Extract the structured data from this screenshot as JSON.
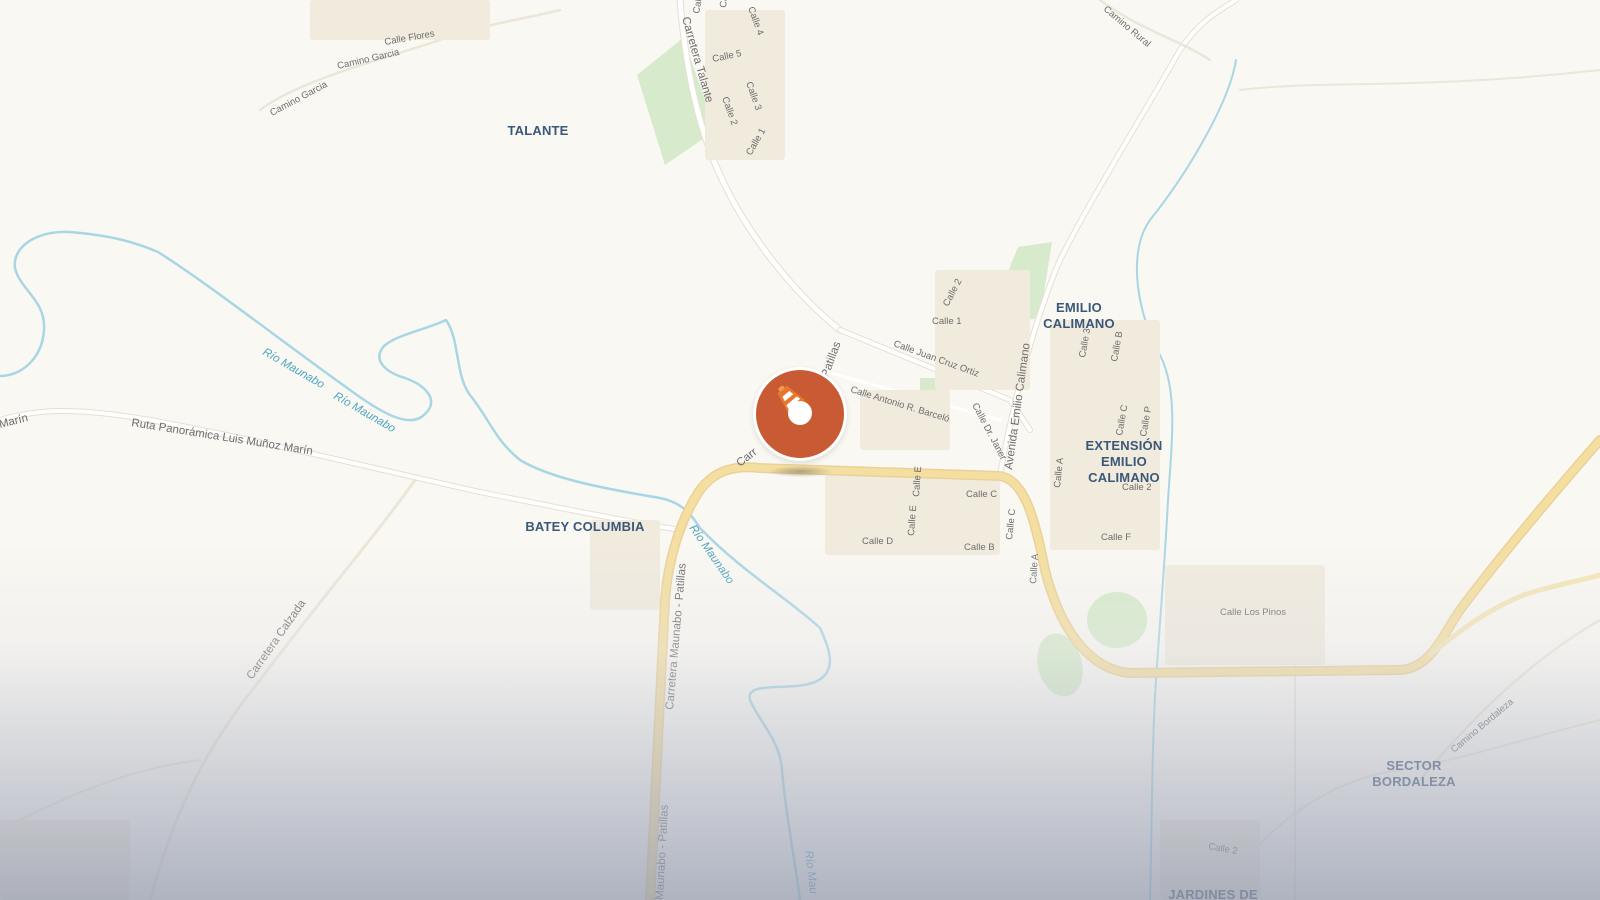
{
  "places": {
    "talante": "TALANTE",
    "batey_columbia": "BATEY COLUMBIA",
    "emilio_1": "EMILIO",
    "emilio_2": "CALIMANO",
    "extension_1": "EXTENSIÓN",
    "extension_2": "EMILIO",
    "extension_3": "CALIMANO",
    "sector_1": "SECTOR",
    "sector_2": "BORDALEZA",
    "jardines": "JARDINES DE"
  },
  "roads": {
    "carretera_talante": "Carretera Talante",
    "ruta_panoramica": "Ruta Panorámica Luis Muñoz Marín",
    "marin": "Marín",
    "carretera_maunabo_patillas": "Carretera Maunabo - Patillas",
    "maunabo_patillas_bottom": "Maunabo - Patillas",
    "carretera_calzada": "Carretera Calzada",
    "avenida_emilio": "Avenida Emilio Calimano",
    "calle_juan_cruz": "Calle Juan Cruz Ortiz",
    "calle_antonio": "Calle Antonio R. Barceló",
    "calle_dr_janer": "Calle Dr. Janer",
    "calle_flores": "Calle Flores",
    "camino_garcia_1": "Camino Garcia",
    "camino_garcia_2": "Camino Garcia",
    "camino_rural": "Camino Rural",
    "camino_bordaleza": "Camino Bordaleza",
    "calle_los_pinos": "Calle Los Pinos",
    "calle_1": "Calle 1",
    "calle_1b": "Calle 1",
    "calle_2": "Calle 2",
    "calle_2b": "Calle 2",
    "calle_2c": "Calle 2",
    "calle_2d": "Calle 2",
    "calle_3": "Calle 3",
    "calle_3b": "Calle 3",
    "calle_4": "Calle 4",
    "calle_5": "Calle 5",
    "calle_a": "Calle A",
    "calle_a2": "Calle A",
    "calle_a3": "Calle A",
    "calle_b": "Calle B",
    "calle_b2": "Calle B",
    "calle_b3": "Calle B",
    "calle_c": "Calle C",
    "calle_c2": "Calle C",
    "calle_c3": "Calle C",
    "calle_d": "Calle D",
    "calle_e": "Calle E",
    "calle_e2": "Calle E",
    "calle_f": "Calle F",
    "calle_p": "Calle P",
    "carr_stub": "Carr",
    "patillas_stub": "Patillas"
  },
  "rivers": {
    "rio_1": "Río Maunabo",
    "rio_2": "Río Maunabo",
    "rio_3": "Río Maunabo",
    "rio_4": "Río Mau"
  },
  "colors": {
    "background": "#faf8f2",
    "major_road": "#f5dfa0",
    "minor_road": "#ffffff",
    "river": "#a9d6e5",
    "park": "#d7ebcc",
    "pin": "#c85a34"
  },
  "marker": {
    "icon": "traffic-cone-icon"
  }
}
